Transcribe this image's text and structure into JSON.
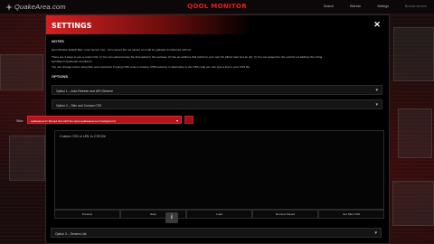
{
  "site": {
    "name": "QuakeArea.com"
  },
  "app": {
    "title": "QOOL MONITOR"
  },
  "nav": {
    "items": [
      "Search",
      "Refresh",
      "Settings",
      "Browse servers"
    ]
  },
  "modal": {
    "title": "SETTINGS",
    "notes_title": "NOTES",
    "notes": [
      "Qool Monitor default filter: mod, Server List – from server but not saved, so it will be updated if redirected with ref.",
      "There are 3 ways to use a custom list: 1) You can edit and save the list loaded in the textarea; 2) Use an address that points to your own list (direct web text as url); 3) You can append to the monitor url address the string",
      "&p=https://mydomain.com/list.txt",
      "You can change colors using Skin and customize it typing CSS code in Custom CSS textarea; in alternative to the CSS code you can type a link to your CSS file"
    ],
    "options_title": "OPTIONS",
    "accordions": [
      "Option 1 – Auto Refresh and URI Scheme",
      "Option 2 – Skin and Custom CSS",
      "Option 3 – Servers List"
    ],
    "skin": {
      "label": "Skin:",
      "value": "quakearea.rtc.flamed skin with the www.quakearea.com background"
    },
    "css_placeholder": "Custom CSS or URL to CSS file",
    "buttons": [
      "Preview",
      "Save",
      "Load",
      "Remove Saved",
      "Get Skin CSS"
    ],
    "close_label": "✕",
    "info_label": "i"
  }
}
